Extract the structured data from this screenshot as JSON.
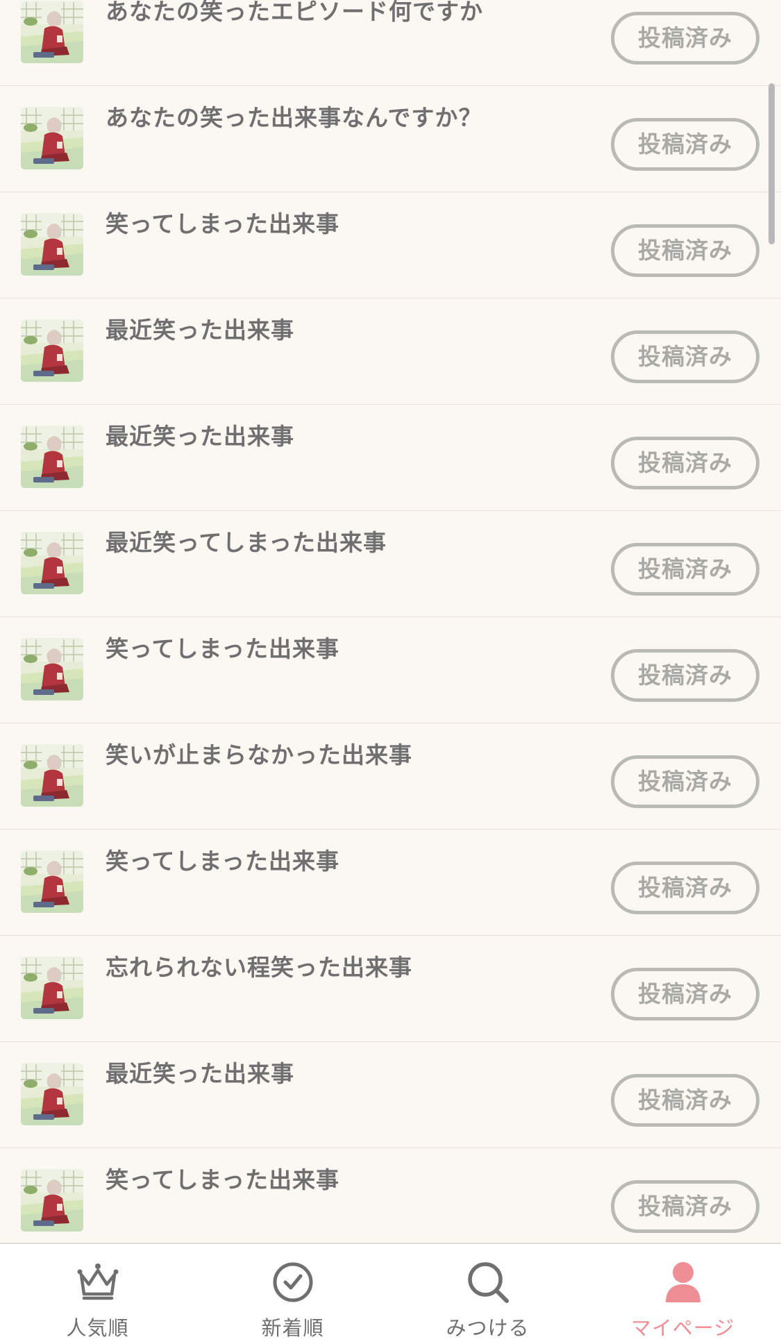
{
  "list": {
    "items": [
      {
        "title": "あなたの笑ったエピソード何ですか",
        "status": "投稿済み"
      },
      {
        "title": "あなたの笑った出来事なんですか？",
        "status": "投稿済み"
      },
      {
        "title": "笑ってしまった出来事",
        "status": "投稿済み"
      },
      {
        "title": "最近笑った出来事",
        "status": "投稿済み"
      },
      {
        "title": "最近笑った出来事",
        "status": "投稿済み"
      },
      {
        "title": "最近笑ってしまった出来事",
        "status": "投稿済み"
      },
      {
        "title": "笑ってしまった出来事",
        "status": "投稿済み"
      },
      {
        "title": "笑いが止まらなかった出来事",
        "status": "投稿済み"
      },
      {
        "title": "笑ってしまった出来事",
        "status": "投稿済み"
      },
      {
        "title": "忘れられない程笑った出来事",
        "status": "投稿済み"
      },
      {
        "title": "最近笑った出来事",
        "status": "投稿済み"
      },
      {
        "title": "笑ってしまった出来事",
        "status": "投稿済み"
      }
    ]
  },
  "tabbar": {
    "tabs": [
      {
        "label": "人気順",
        "icon": "crown-icon"
      },
      {
        "label": "新着順",
        "icon": "clock-icon"
      },
      {
        "label": "みつける",
        "icon": "search-icon"
      },
      {
        "label": "マイページ",
        "icon": "person-icon"
      }
    ],
    "active_index": 3
  },
  "colors": {
    "text": "#6f6f6f",
    "button_border": "#b9b9b5",
    "active_tab": "#ef8f95"
  }
}
